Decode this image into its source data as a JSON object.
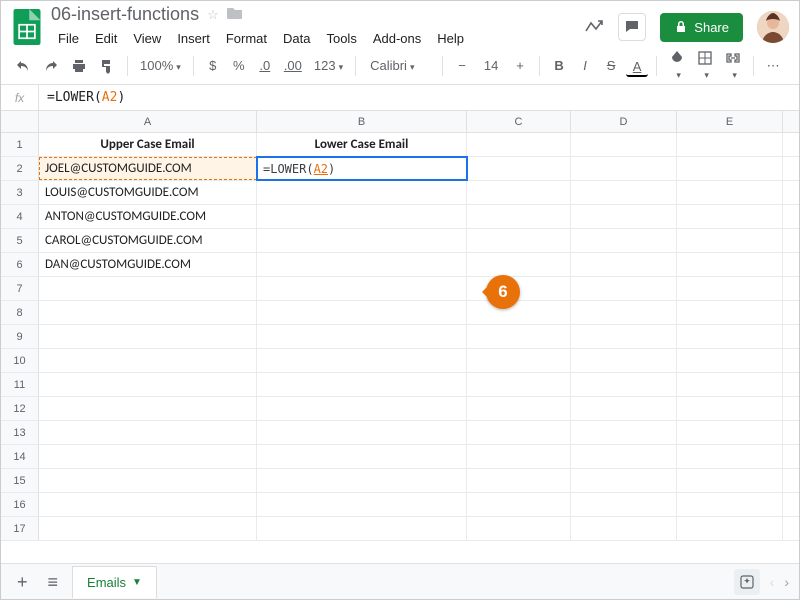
{
  "doc": {
    "title": "06-insert-functions"
  },
  "menu": {
    "file": "File",
    "edit": "Edit",
    "view": "View",
    "insert": "Insert",
    "format": "Format",
    "data": "Data",
    "tools": "Tools",
    "addons": "Add-ons",
    "help": "Help"
  },
  "toolbar": {
    "zoom": "100%",
    "currency": "$",
    "percent": "%",
    "dec_dec": ".0",
    "dec_inc": ".00",
    "num_fmt": "123",
    "font": "Calibri",
    "size": "14",
    "bold": "B",
    "italic": "I",
    "strike": "S",
    "textcolor": "A",
    "more": "⋯"
  },
  "share": {
    "label": "Share"
  },
  "formula": {
    "fx": "fx",
    "prefix": "=LOWER(",
    "ref": "A2",
    "suffix": ")"
  },
  "columns": {
    "A": "A",
    "B": "B",
    "C": "C",
    "D": "D",
    "E": "E"
  },
  "rows": {
    "r1": {
      "A": "Upper Case Email",
      "B": "Lower Case Email"
    },
    "r2": {
      "A": "JOEL@CUSTOMGUIDE.COM",
      "B_prefix": "=LOWER(",
      "B_ref": "A2",
      "B_suffix": ")"
    },
    "r3": {
      "A": "LOUIS@CUSTOMGUIDE.COM"
    },
    "r4": {
      "A": "ANTON@CUSTOMGUIDE.COM"
    },
    "r5": {
      "A": "CAROL@CUSTOMGUIDE.COM"
    },
    "r6": {
      "A": "DAN@CUSTOMGUIDE.COM"
    }
  },
  "sheet": {
    "add": "+",
    "all": "≡",
    "tab1": "Emails"
  },
  "callout": {
    "num": "6"
  }
}
